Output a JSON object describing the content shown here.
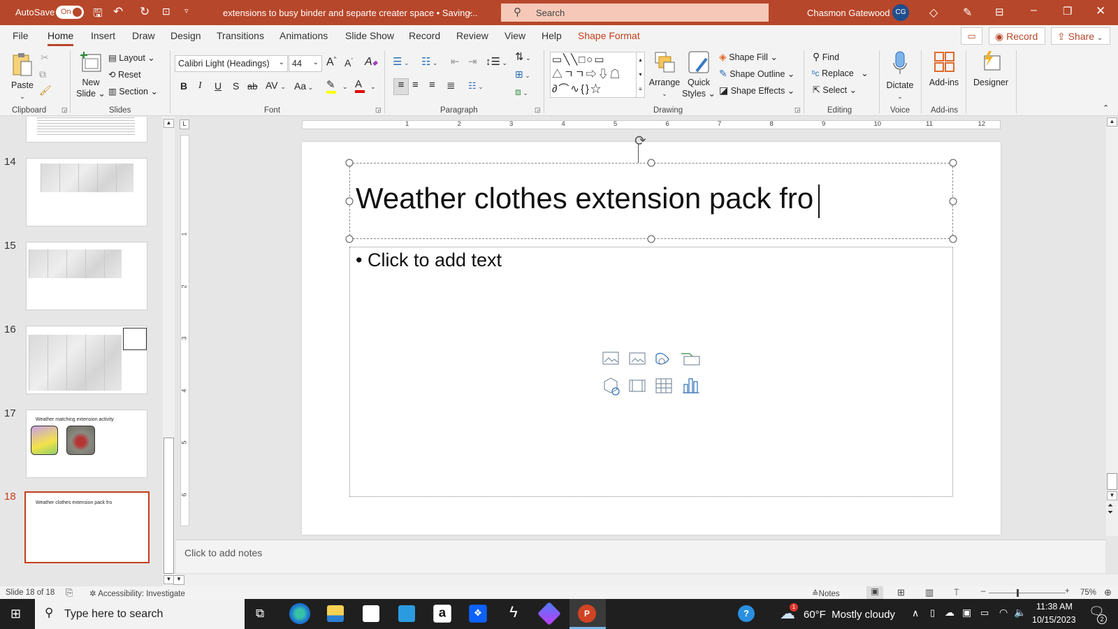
{
  "titlebar": {
    "autosave_label": "AutoSave",
    "autosave_state": "On",
    "document_title": "extensions to busy binder and separte creater space • Saving...",
    "search_placeholder": "Search",
    "user_name": "Chasmon Gatewood",
    "user_initials": "CG"
  },
  "tabs": [
    "File",
    "Home",
    "Insert",
    "Draw",
    "Design",
    "Transitions",
    "Animations",
    "Slide Show",
    "Record",
    "Review",
    "View",
    "Help",
    "Shape Format"
  ],
  "tab_actions": {
    "record": "Record",
    "share": "Share"
  },
  "ribbon": {
    "clipboard": {
      "label": "Clipboard",
      "paste": "Paste"
    },
    "slides": {
      "label": "Slides",
      "new_slide": [
        "New",
        "Slide"
      ],
      "layout": "Layout",
      "reset": "Reset",
      "section": "Section"
    },
    "font": {
      "label": "Font",
      "font_name": "Calibri Light (Headings)",
      "font_size": "44",
      "bold": "B",
      "italic": "I",
      "underline": "U",
      "shadow": "S",
      "strike": "ab",
      "spacing": "AV",
      "case": "Aa",
      "highlight_color": "#ffff00",
      "font_color": "#e00000"
    },
    "paragraph": {
      "label": "Paragraph"
    },
    "drawing": {
      "label": "Drawing",
      "arrange": "Arrange",
      "quick_styles": [
        "Quick",
        "Styles"
      ],
      "shape_fill": "Shape Fill",
      "shape_outline": "Shape Outline",
      "shape_effects": "Shape Effects"
    },
    "editing": {
      "label": "Editing",
      "find": "Find",
      "replace": "Replace",
      "select": "Select"
    },
    "voice": {
      "label": "Voice",
      "dictate": "Dictate"
    },
    "addins": {
      "label": "Add-ins",
      "addins": "Add-ins"
    },
    "designer": {
      "label": "Designer"
    }
  },
  "slides_pane": {
    "current": 18,
    "thumbnails": [
      {
        "number": "14"
      },
      {
        "number": "15"
      },
      {
        "number": "16"
      },
      {
        "number": "17",
        "title": "Weather matching extension activity"
      },
      {
        "number": "18",
        "title": "Weather clothes extension pack fro"
      }
    ]
  },
  "ruler": {
    "h_labels": [
      "1",
      "2",
      "3",
      "4",
      "5",
      "6",
      "7",
      "8",
      "9",
      "10",
      "11",
      "12"
    ],
    "v_labels": [
      "1",
      "2",
      "3",
      "4",
      "5",
      "6"
    ]
  },
  "slide": {
    "title": "Weather clothes extension pack fro",
    "body_placeholder": "Click to add text"
  },
  "notes": {
    "placeholder": "Click to add notes"
  },
  "statusbar": {
    "slide_info": "Slide 18 of 18",
    "accessibility": "Accessibility: Investigate",
    "notes": "Notes",
    "zoom": "75%",
    "zoom_level": 75
  },
  "taskbar": {
    "search_placeholder": "Type here to search",
    "weather": "60°F  Mostly cloudy",
    "weather_badge": "1",
    "time": "11:38 AM",
    "date": "10/15/2023",
    "notification_count": "2"
  },
  "colors": {
    "accent": "#b7472a",
    "selected_thumb": "#c43e1c"
  }
}
